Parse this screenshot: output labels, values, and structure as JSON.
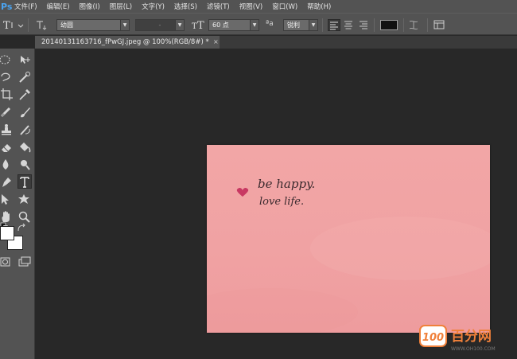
{
  "app": {
    "logo": "Ps"
  },
  "menus": [
    "文件(F)",
    "编辑(E)",
    "图像(I)",
    "图层(L)",
    "文字(Y)",
    "选择(S)",
    "滤镜(T)",
    "视图(V)",
    "窗口(W)",
    "帮助(H)"
  ],
  "options": {
    "font_family": "幼圆",
    "font_style": "-",
    "font_size": "60 点",
    "aa_label": "ªa",
    "aa_method": "锐利",
    "text_color": "#111111"
  },
  "document_tab": {
    "title": "20140131163716_fPwGJ.jpeg @ 100%(RGB/8#) *",
    "close": "×"
  },
  "tools": {
    "foreground_color": "#ffffff",
    "background_color": "#ffffff"
  },
  "image": {
    "background_color": "#f0a3a4",
    "handwriting_line1": "be happy.",
    "handwriting_line2": "love life.",
    "heart_color": "#c83862"
  },
  "watermark": {
    "badge": "100",
    "text": "百分网",
    "subtext": "WWW.OH100.COM",
    "color": "#f0803a"
  }
}
